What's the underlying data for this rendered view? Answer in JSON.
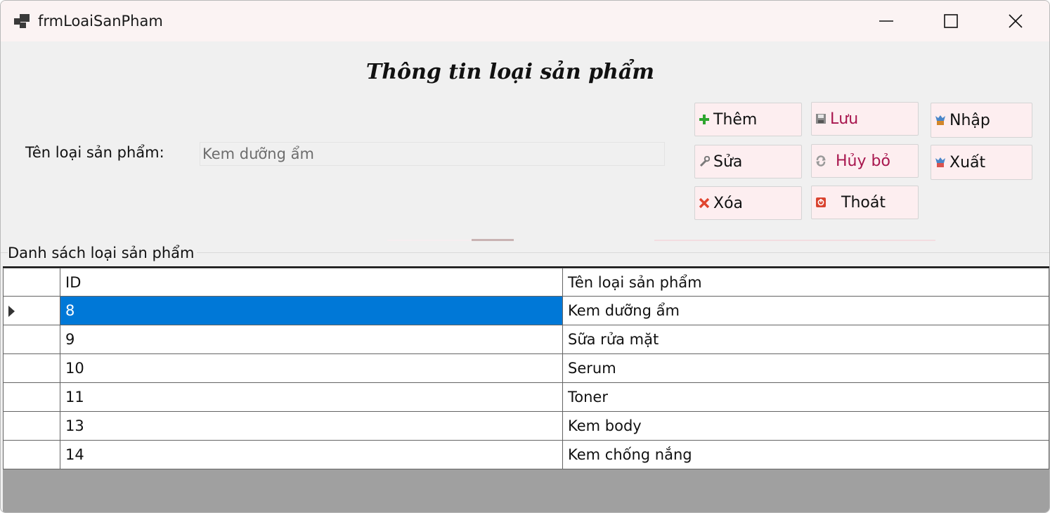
{
  "window": {
    "title": "frmLoaiSanPham"
  },
  "form": {
    "heading": "Thông tin loại sản phẩm",
    "name_label": "Tên loại sản phẩm:",
    "name_value": "Kem dưỡng ẩm"
  },
  "buttons": {
    "them": "Thêm",
    "luu": "Lưu",
    "nhap": "Nhập",
    "sua": "Sửa",
    "huybo": "Hủy bỏ",
    "xuat": "Xuất",
    "xoa": "Xóa",
    "thoat": "Thoát"
  },
  "list": {
    "group_label": "Danh sách loại sản phẩm",
    "columns": [
      "ID",
      "Tên loại sản phẩm"
    ],
    "rows": [
      {
        "id": "8",
        "name": "Kem dưỡng ẩm",
        "selected": true
      },
      {
        "id": "9",
        "name": "Sữa rửa mặt"
      },
      {
        "id": "10",
        "name": "Serum"
      },
      {
        "id": "11",
        "name": "Toner"
      },
      {
        "id": "13",
        "name": "Kem body"
      },
      {
        "id": "14",
        "name": "Kem chống nắng"
      }
    ]
  },
  "icons": {
    "app": "app-window-icon",
    "them": "plus-icon",
    "luu": "save-icon",
    "nhap": "import-icon",
    "sua": "wrench-icon",
    "huybo": "undo-icon",
    "xuat": "export-icon",
    "xoa": "delete-x-icon",
    "thoat": "exit-icon"
  },
  "colors": {
    "selection": "#0078d7",
    "button_bg": "#fdeef0",
    "button_text_alt": "#a8164e",
    "grid_background": "#a0a0a0"
  }
}
